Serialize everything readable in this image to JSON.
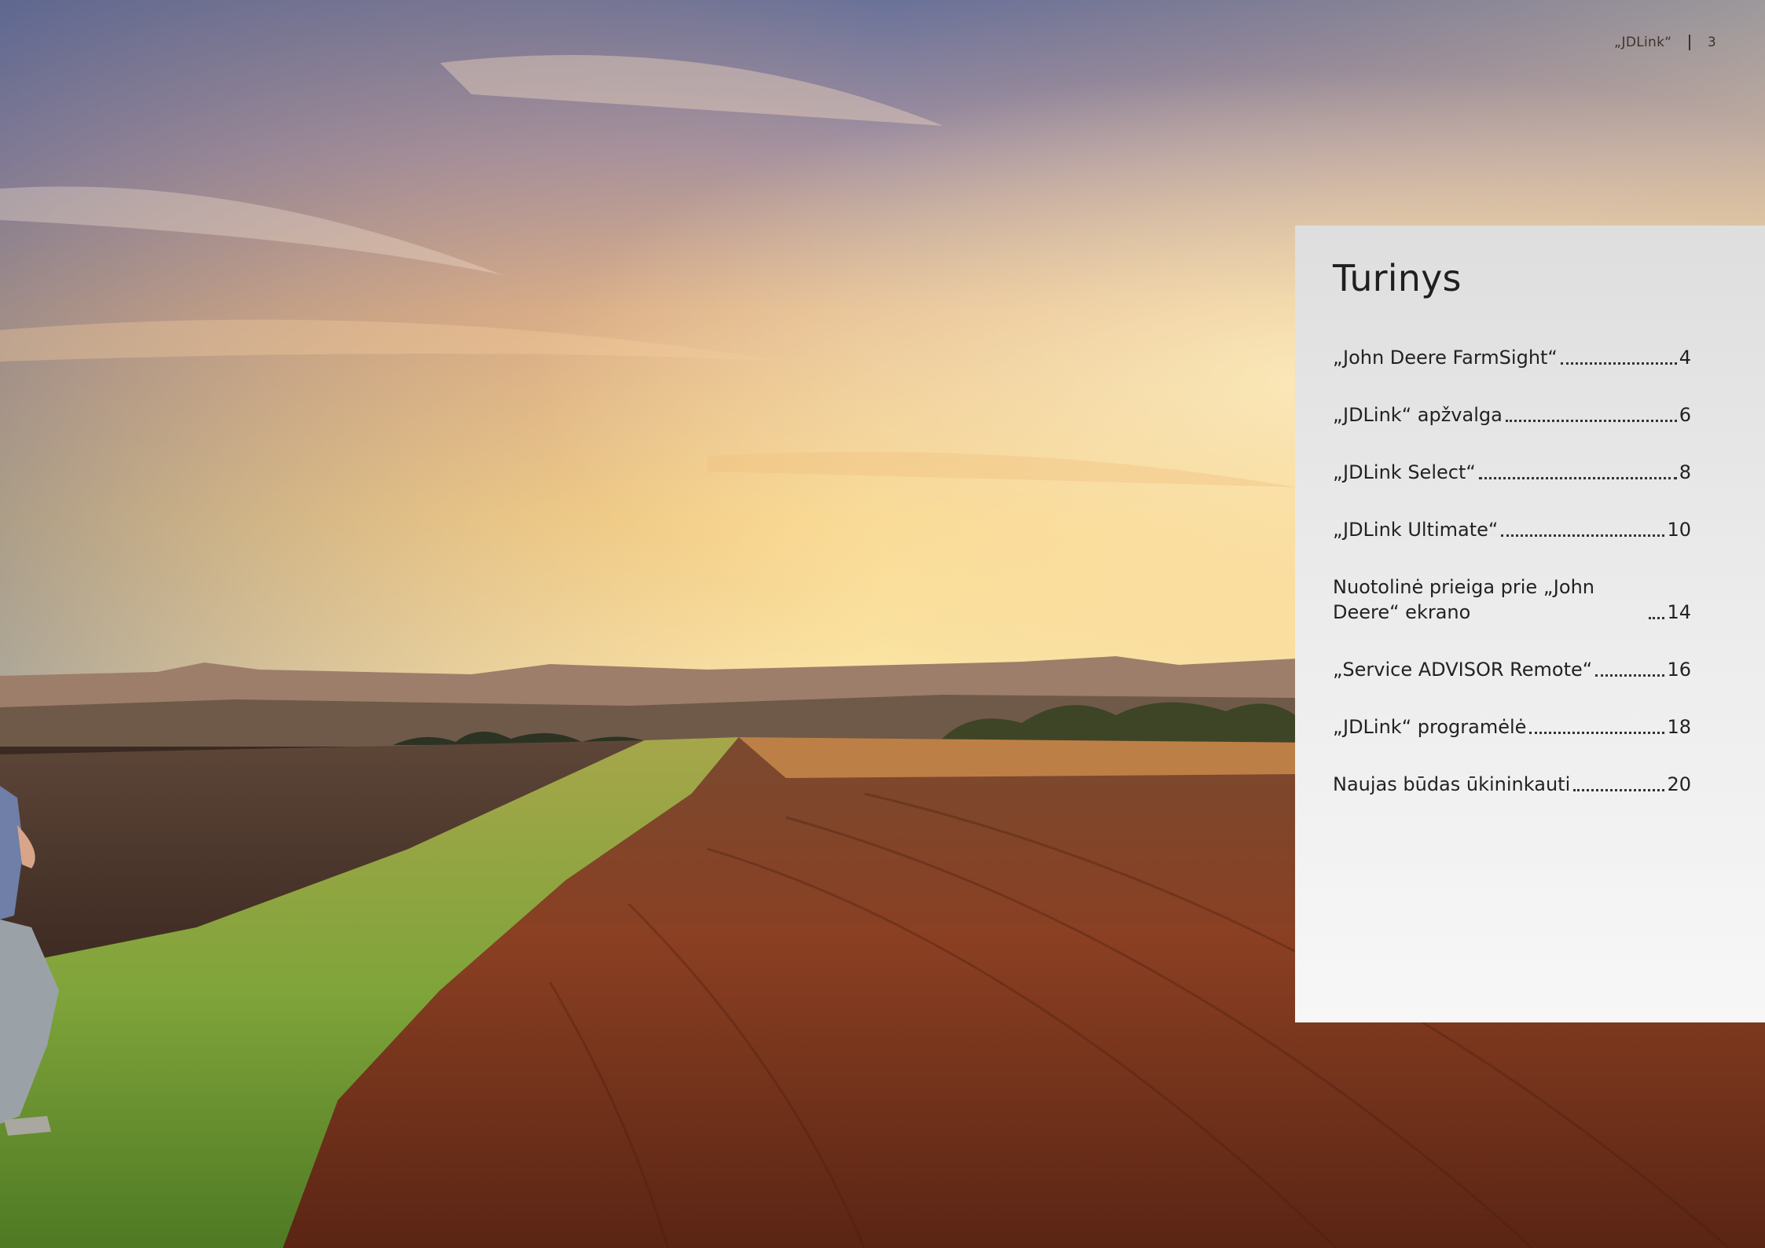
{
  "header": {
    "title": "„JDLink“",
    "page_number": "3"
  },
  "toc": {
    "title": "Turinys",
    "items": [
      {
        "label": "„John Deere FarmSight“",
        "page": "4"
      },
      {
        "label": "„JDLink“ apžvalga",
        "page": "6"
      },
      {
        "label": "„JDLink Select“",
        "page": "8"
      },
      {
        "label": "„JDLink Ultimate“",
        "page": "10"
      },
      {
        "label": "Nuotolinė prieiga prie „John Deere“ ekrano",
        "page": "14"
      },
      {
        "label": "„Service ADVISOR Remote“",
        "page": "16"
      },
      {
        "label": "„JDLink“ programėlė",
        "page": "18"
      },
      {
        "label": "Naujas būdas ūkininkauti",
        "page": "20"
      }
    ]
  },
  "colors": {
    "panel_bg": "#e6e6e6",
    "sky_top": "#6a7299",
    "sky_horizon": "#f8d58a",
    "soil": "#8a3f22",
    "grass": "#7fa43a"
  }
}
